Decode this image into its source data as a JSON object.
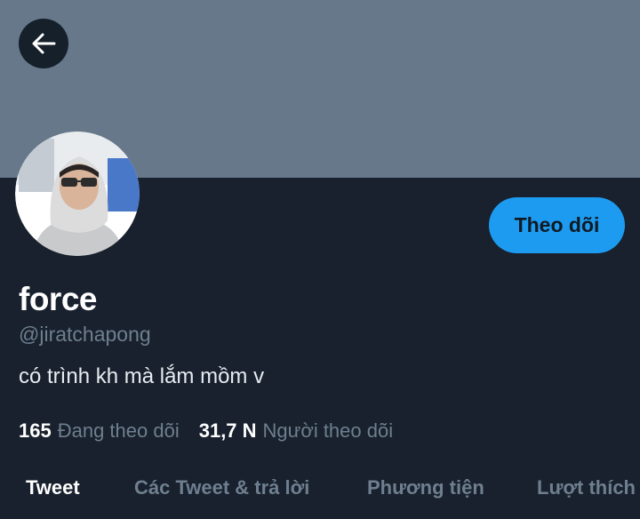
{
  "profile": {
    "display_name": "force",
    "handle": "@jiratchapong",
    "bio": "có trình kh mà lắm mồm v",
    "follow_label": "Theo dõi"
  },
  "stats": {
    "following_count": "165",
    "following_label": "Đang theo dõi",
    "followers_count": "31,7 N",
    "followers_label": "Người theo dõi"
  },
  "tabs": [
    {
      "label": "Tweet",
      "active": true
    },
    {
      "label": "Các Tweet & trả lời",
      "active": false
    },
    {
      "label": "Phương tiện",
      "active": false
    },
    {
      "label": "Lượt thích",
      "active": false
    }
  ],
  "icons": {
    "back": "arrow-left-icon"
  },
  "colors": {
    "banner": "#66788a",
    "background": "#18212d",
    "accent": "#1d9bf0",
    "muted_text": "#6f7f8f"
  }
}
